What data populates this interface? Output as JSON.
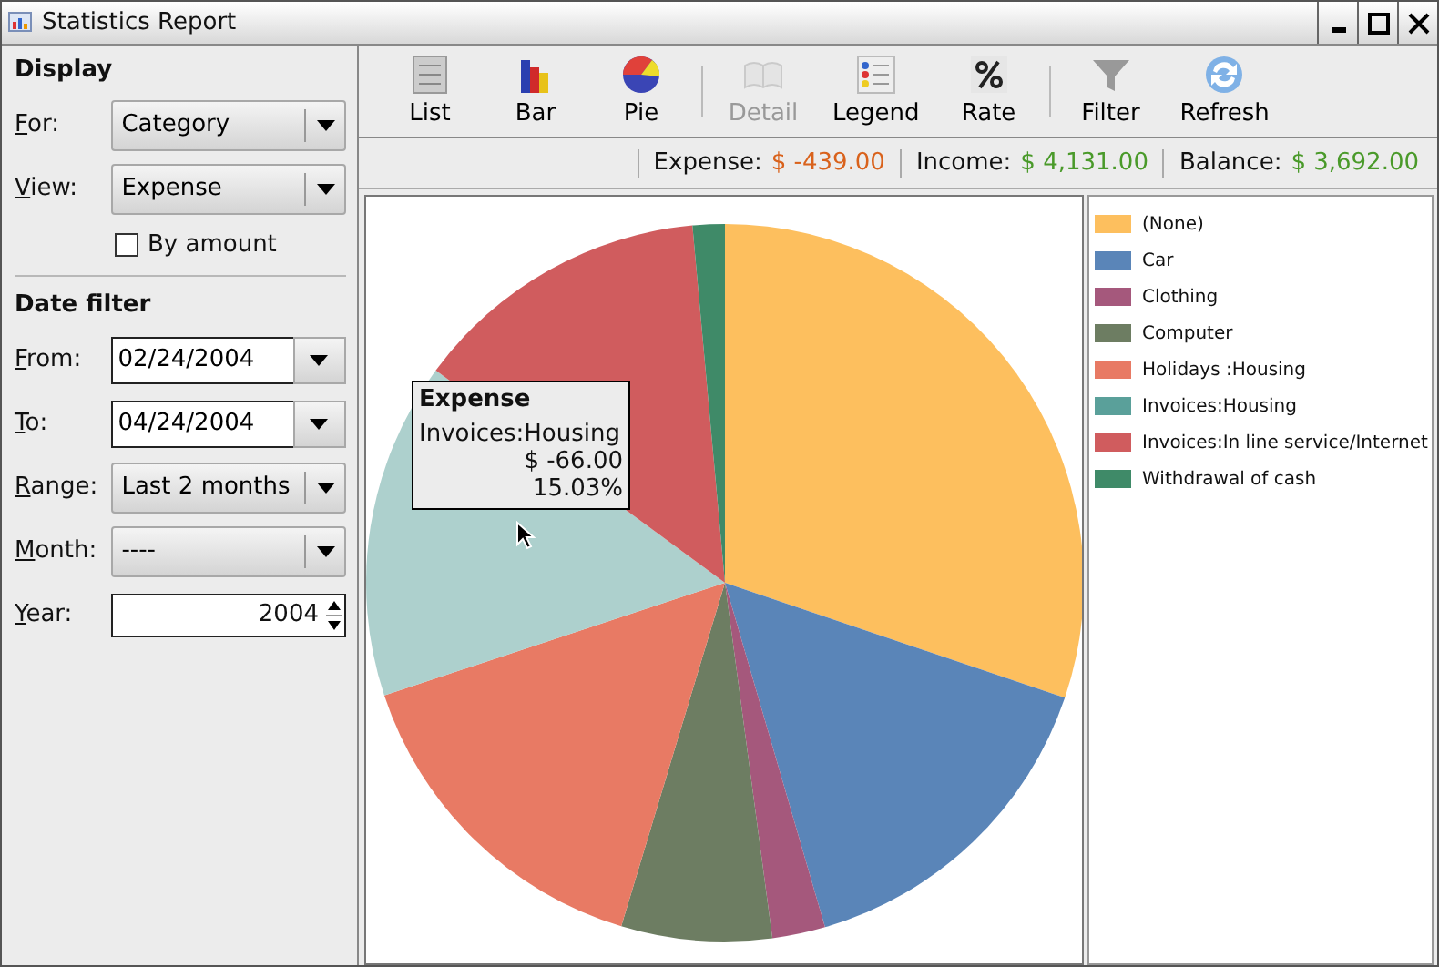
{
  "window": {
    "title": "Statistics Report"
  },
  "display": {
    "title": "Display",
    "for": {
      "label": "For:",
      "value": "Category"
    },
    "view": {
      "label": "View:",
      "value": "Expense"
    },
    "by_amount": {
      "label": "By amount",
      "checked": false
    }
  },
  "date_filter": {
    "title": "Date filter",
    "from": {
      "label": "From:",
      "value": "02/24/2004"
    },
    "to": {
      "label": "To:",
      "value": "04/24/2004"
    },
    "range": {
      "label": "Range:",
      "value": "Last 2 months"
    },
    "month": {
      "label": "Month:",
      "value": "----"
    },
    "year": {
      "label": "Year:",
      "value": "2004"
    }
  },
  "toolbar": {
    "groups": [
      [
        {
          "label": "List",
          "disabled": false
        },
        {
          "label": "Bar",
          "disabled": false
        },
        {
          "label": "Pie",
          "disabled": false
        }
      ],
      [
        {
          "label": "Detail",
          "disabled": true
        },
        {
          "label": "Legend",
          "disabled": false
        },
        {
          "label": "Rate",
          "disabled": false
        }
      ],
      [
        {
          "label": "Filter",
          "disabled": false
        },
        {
          "label": "Refresh",
          "disabled": false
        }
      ]
    ]
  },
  "summary": [
    {
      "label": "Expense:",
      "value": "$ -439.00",
      "color": "#d9621c"
    },
    {
      "label": "Income:",
      "value": "$ 4,131.00",
      "color": "#4a9a2a"
    },
    {
      "label": "Balance:",
      "value": "$ 3,692.00",
      "color": "#4a9a2a"
    }
  ],
  "legend": [
    {
      "label": "(None)",
      "color": "#fdbf5e"
    },
    {
      "label": "Car",
      "color": "#5a85b8"
    },
    {
      "label": "Clothing",
      "color": "#a5587c"
    },
    {
      "label": "Computer",
      "color": "#6d7d62"
    },
    {
      "label": "Holidays :Housing",
      "color": "#e87a64"
    },
    {
      "label": "Invoices:Housing",
      "color": "#5aa09a"
    },
    {
      "label": "Invoices:In line service/Internet",
      "color": "#d05c5e"
    },
    {
      "label": "Withdrawal of cash",
      "color": "#3f8a68"
    }
  ],
  "tooltip": {
    "title": "Expense",
    "category": "Invoices:Housing",
    "amount": "$ -66.00",
    "percent": "15.03%"
  }
}
